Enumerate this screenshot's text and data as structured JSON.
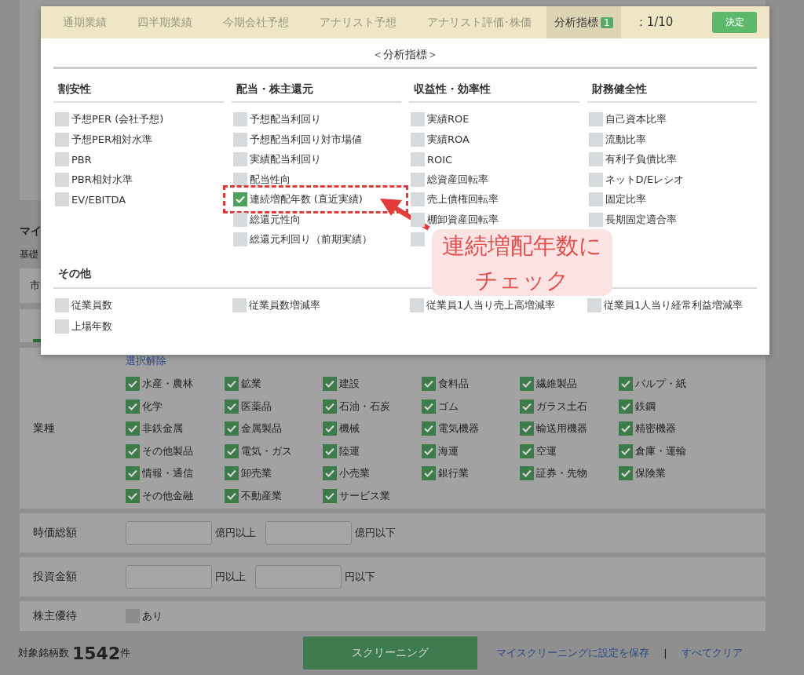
{
  "background": {
    "heading_fragment": "マイ",
    "label_fragment": "基礎",
    "row_fragment": "市",
    "industry": {
      "label": "業種",
      "clear_link": "選択解除",
      "items": [
        {
          "label": "水産・農林",
          "checked": true
        },
        {
          "label": "鉱業",
          "checked": true
        },
        {
          "label": "建設",
          "checked": true
        },
        {
          "label": "食料品",
          "checked": true
        },
        {
          "label": "繊維製品",
          "checked": true
        },
        {
          "label": "パルプ・紙",
          "checked": true
        },
        {
          "label": "化学",
          "checked": true
        },
        {
          "label": "医薬品",
          "checked": true
        },
        {
          "label": "石油・石炭",
          "checked": true
        },
        {
          "label": "ゴム",
          "checked": true
        },
        {
          "label": "ガラス土石",
          "checked": true
        },
        {
          "label": "鉄鋼",
          "checked": true
        },
        {
          "label": "非鉄金属",
          "checked": true
        },
        {
          "label": "金属製品",
          "checked": true
        },
        {
          "label": "機械",
          "checked": true
        },
        {
          "label": "電気機器",
          "checked": true
        },
        {
          "label": "輸送用機器",
          "checked": true
        },
        {
          "label": "精密機器",
          "checked": true
        },
        {
          "label": "その他製品",
          "checked": true
        },
        {
          "label": "電気・ガス",
          "checked": true
        },
        {
          "label": "陸運",
          "checked": true
        },
        {
          "label": "海運",
          "checked": true
        },
        {
          "label": "空運",
          "checked": true
        },
        {
          "label": "倉庫・運輸",
          "checked": true
        },
        {
          "label": "情報・通信",
          "checked": true
        },
        {
          "label": "卸売業",
          "checked": true
        },
        {
          "label": "小売業",
          "checked": true
        },
        {
          "label": "銀行業",
          "checked": true
        },
        {
          "label": "証券・先物",
          "checked": true
        },
        {
          "label": "保険業",
          "checked": true
        },
        {
          "label": "その他金融",
          "checked": true
        },
        {
          "label": "不動産業",
          "checked": true
        },
        {
          "label": "サービス業",
          "checked": true
        }
      ]
    },
    "ranges": [
      {
        "label": "時価総額",
        "min_unit": "億円以上",
        "max_unit": "億円以下"
      },
      {
        "label": "投資金額",
        "min_unit": "円以上",
        "max_unit": "円以下"
      }
    ],
    "benefit": {
      "label": "株主優待",
      "option": {
        "label": "あり",
        "checked": false
      }
    },
    "footer": {
      "count_label": "対象銘柄数",
      "count": "1542",
      "count_unit": "件",
      "screen_button": "スクリーニング",
      "save_link": "マイスクリーニングに設定を保存",
      "separator": "|",
      "clear_link": "すべてクリア"
    }
  },
  "modal": {
    "tabs": [
      {
        "label": "通期業績",
        "selected": false
      },
      {
        "label": "四半期業績",
        "selected": false
      },
      {
        "label": "今期会社予想",
        "selected": false
      },
      {
        "label": "アナリスト予想",
        "selected": false
      },
      {
        "label": "アナリスト評価･株価",
        "selected": false
      },
      {
        "label": "分析指標",
        "selected": true,
        "badge": "1"
      }
    ],
    "counter": "：1/10",
    "confirm_button": "決定",
    "title": "＜分析指標＞",
    "columns": [
      {
        "heading": "割安性",
        "items": [
          {
            "label": "予想PER (会社予想)",
            "checked": false
          },
          {
            "label": "予想PER相対水準",
            "checked": false
          },
          {
            "label": "PBR",
            "checked": false
          },
          {
            "label": "PBR相対水準",
            "checked": false
          },
          {
            "label": "EV/EBITDA",
            "checked": false
          }
        ]
      },
      {
        "heading": "配当・株主還元",
        "items": [
          {
            "label": "予想配当利回り",
            "checked": false
          },
          {
            "label": "予想配当利回り対市場値",
            "checked": false
          },
          {
            "label": "実績配当利回り",
            "checked": false
          },
          {
            "label": "配当性向",
            "checked": false
          },
          {
            "label": "連続増配年数 (直近実績)",
            "checked": true,
            "highlight": true
          },
          {
            "label": "総還元性向",
            "checked": false
          },
          {
            "label": "総還元利回り（前期実績）",
            "checked": false
          }
        ]
      },
      {
        "heading": "収益性・効率性",
        "items": [
          {
            "label": "実績ROE",
            "checked": false
          },
          {
            "label": "実績ROA",
            "checked": false
          },
          {
            "label": "ROIC",
            "checked": false
          },
          {
            "label": "総資産回転率",
            "checked": false
          },
          {
            "label": "売上債権回転率",
            "checked": false
          },
          {
            "label": "棚卸資産回転率",
            "checked": false
          },
          {
            "checked": false
          }
        ]
      },
      {
        "heading": "財務健全性",
        "items": [
          {
            "label": "自己資本比率",
            "checked": false
          },
          {
            "label": "流動比率",
            "checked": false
          },
          {
            "label": "有利子負債比率",
            "checked": false
          },
          {
            "label": "ネットD/Eレシオ",
            "checked": false
          },
          {
            "label": "固定比率",
            "checked": false
          },
          {
            "label": "長期固定適合率",
            "checked": false
          }
        ]
      }
    ],
    "other": {
      "heading": "その他",
      "items": [
        {
          "label": "従業員数",
          "checked": false
        },
        {
          "label": "従業員数増減率",
          "checked": false
        },
        {
          "label": "従業員1人当り売上高増減率",
          "checked": false
        },
        {
          "label": "従業員1人当り経常利益増減率",
          "checked": false
        },
        {
          "label": "上場年数",
          "checked": false
        }
      ]
    }
  },
  "annotation": {
    "callout_lines": [
      "連続増配年数に",
      "チェック"
    ]
  }
}
